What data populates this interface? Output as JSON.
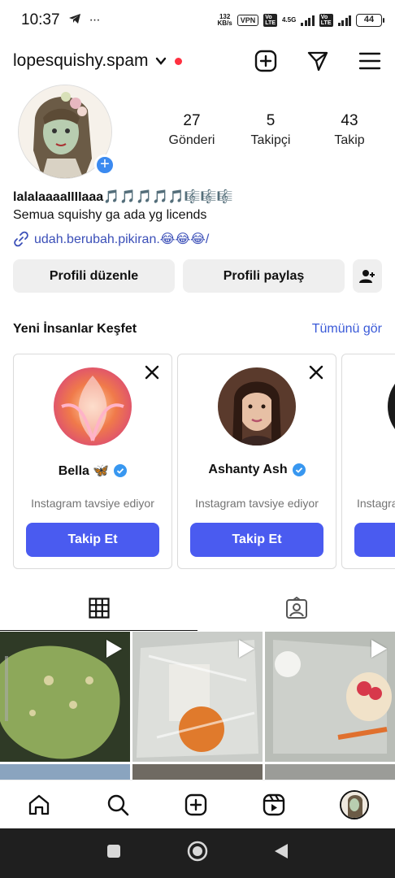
{
  "status_bar": {
    "time": "10:37",
    "net_speed_value": "132",
    "net_speed_unit": "KB/s",
    "vpn": "VPN",
    "network": "4.5G",
    "battery": "44"
  },
  "header": {
    "username": "lopesquishy.spam"
  },
  "profile": {
    "stats": [
      {
        "value": "27",
        "label": "Gönderi"
      },
      {
        "value": "5",
        "label": "Takipçi"
      },
      {
        "value": "43",
        "label": "Takip"
      }
    ],
    "bio_name": "lalalaaaaIIIIaaa🎵🎵🎵🎵🎵🎼🎼🎼",
    "bio_text": "Semua squishy ga ada yg licends",
    "bio_link": "udah.berubah.pikiran.😂😂😂/"
  },
  "buttons": {
    "edit_profile": "Profili düzenle",
    "share_profile": "Profili paylaş"
  },
  "discover": {
    "title": "Yeni İnsanlar Keşfet",
    "see_all": "Tümünü gör",
    "cards": [
      {
        "name": "Bella 🦋",
        "subtitle": "Instagram tavsiye ediyor",
        "follow": "Takip Et"
      },
      {
        "name": "Ashanty Ash",
        "subtitle": "Instagram tavsiye ediyor",
        "follow": "Takip Et"
      },
      {
        "name": "",
        "subtitle": "Instagra",
        "follow": ""
      }
    ]
  },
  "colors": {
    "primary_button": "#4a5bf0",
    "link": "#3b4fb8",
    "verified": "#3897f0",
    "notification_dot": "#ff3040"
  }
}
